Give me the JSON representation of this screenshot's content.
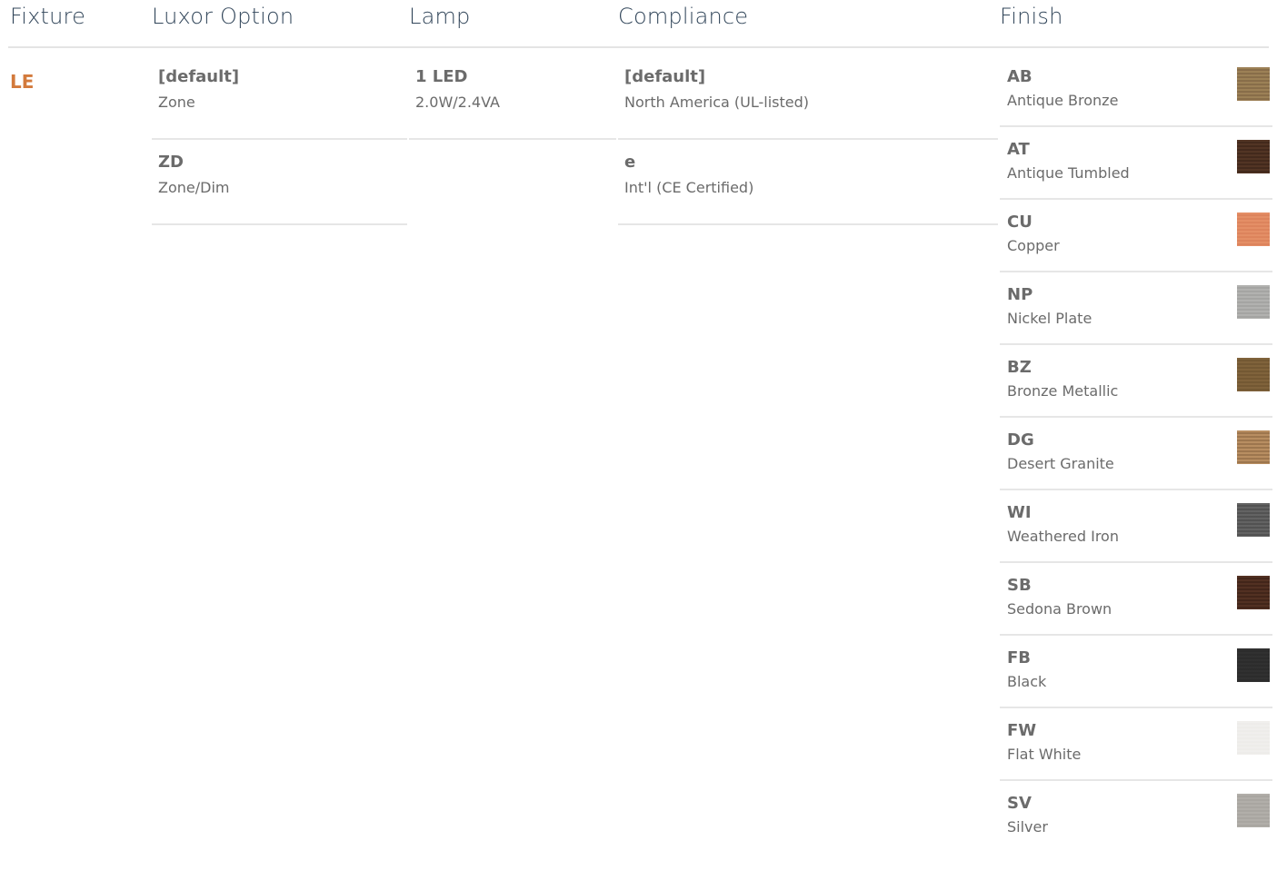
{
  "headers": {
    "fixture": "Fixture",
    "luxor_option": "Luxor Option",
    "lamp": "Lamp",
    "compliance": "Compliance",
    "finish": "Finish"
  },
  "fixture": {
    "code": "LE",
    "color": "#d37a3c"
  },
  "luxor_options": [
    {
      "code": "[default]",
      "desc": "Zone"
    },
    {
      "code": "ZD",
      "desc": "Zone/Dim"
    }
  ],
  "lamp_options": [
    {
      "code": "1 LED",
      "desc": "2.0W/2.4VA"
    }
  ],
  "compliance_options": [
    {
      "code": "[default]",
      "desc": "North America (UL-listed)"
    },
    {
      "code": "e",
      "desc": "Int'l (CE Certified)"
    }
  ],
  "finishes": [
    {
      "code": "AB",
      "name": "Antique Bronze",
      "swatch": "#a68a5c",
      "swatch2": "#7e6443"
    },
    {
      "code": "AT",
      "name": "Antique Tumbled",
      "swatch": "#5a3a28",
      "swatch2": "#3b2418"
    },
    {
      "code": "CU",
      "name": "Copper",
      "swatch": "#e8946b",
      "swatch2": "#d97e57"
    },
    {
      "code": "NP",
      "name": "Nickel Plate",
      "swatch": "#b8b8b6",
      "swatch2": "#9e9e9c"
    },
    {
      "code": "BZ",
      "name": "Bronze Metallic",
      "swatch": "#86683f",
      "swatch2": "#6d532f"
    },
    {
      "code": "DG",
      "name": "Desert Granite",
      "swatch": "#c69a6b",
      "swatch2": "#8f6a44"
    },
    {
      "code": "WI",
      "name": "Weathered Iron",
      "swatch": "#6b6b6b",
      "swatch2": "#4a4a4a"
    },
    {
      "code": "SB",
      "name": "Sedona Brown",
      "swatch": "#5a3626",
      "swatch2": "#3a2016"
    },
    {
      "code": "FB",
      "name": "Black",
      "swatch": "#333333",
      "swatch2": "#2a2a2a"
    },
    {
      "code": "FW",
      "name": "Flat White",
      "swatch": "#f1f0ee",
      "swatch2": "#ecebe8"
    },
    {
      "code": "SV",
      "name": "Silver",
      "swatch": "#b5b2ad",
      "swatch2": "#a5a29d"
    }
  ],
  "colors": {
    "header_text": "#33475b",
    "body_text": "#6b6b6b",
    "rule": "#e4e4e4"
  }
}
